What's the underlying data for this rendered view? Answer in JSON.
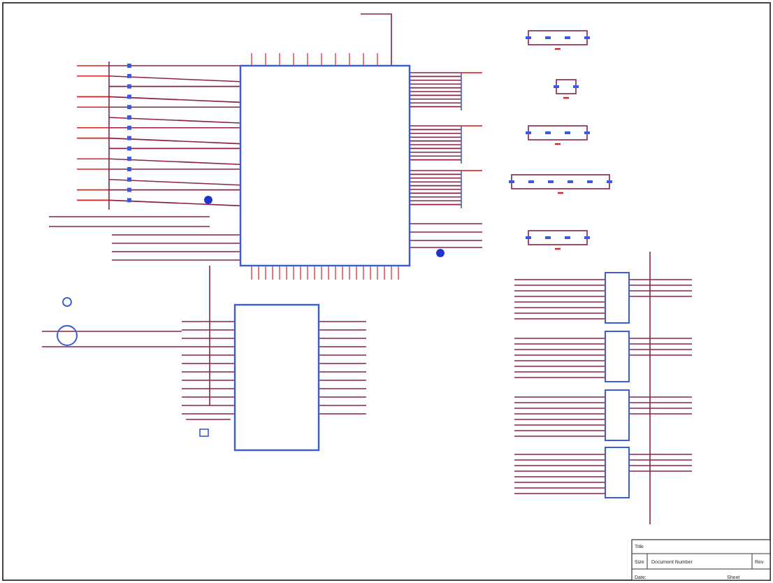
{
  "title_block": {
    "fields": [
      {
        "label": "Title"
      },
      {
        "label": "Size"
      },
      {
        "label": "Document Number"
      },
      {
        "label": "Rev"
      },
      {
        "label": "Date:"
      },
      {
        "label": "Sheet"
      }
    ]
  }
}
